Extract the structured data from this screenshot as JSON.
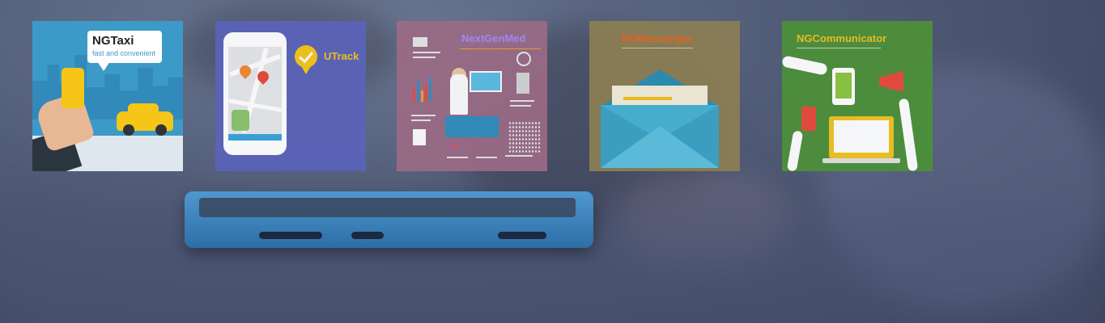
{
  "banner": {
    "apps": [
      {
        "title": "NGTaxi",
        "tagline": "fast and convenient",
        "bg": "#3c9ac8"
      },
      {
        "title": "UTrack",
        "bg": "#5b63b8",
        "accent": "#f5c518"
      },
      {
        "title": "NextGenMed",
        "bg": "#9b6b86",
        "accent": "#9f8dff",
        "filler_text": [
          "Lorem ipsum dolor",
          "Lorem ipsum dolor",
          "Sit amet consectetur",
          "Lorem ipsum"
        ]
      },
      {
        "title": "NGMessenger",
        "bg": "#8c7f54",
        "accent": "#f0641e",
        "icon": "envelope-icon"
      },
      {
        "title": "NGCommunicator",
        "bg": "#4c8f3a",
        "accent": "#f0c21e",
        "icon": "megaphone-icon"
      }
    ]
  },
  "colors": {
    "background": "#525d78",
    "phone": "#4f98cf"
  }
}
